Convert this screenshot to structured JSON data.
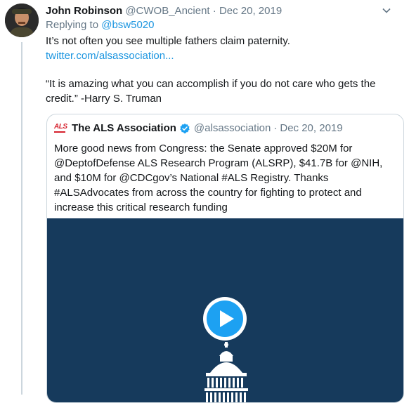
{
  "tweet": {
    "author_name": "John Robinson",
    "handle": "@CWOB_Ancient",
    "separator": "·",
    "date": "Dec 20, 2019",
    "replying_to_label": "Replying to",
    "replying_to_handle": "@bsw5020",
    "line1": "It’s not often you see multiple fathers claim paternity.",
    "link": "twitter.com/alsassociation...",
    "quote_line": "“It is amazing what you can accomplish if you do not care who gets the credit.” -Harry S. Truman"
  },
  "quoted": {
    "logo_text": "ALS",
    "name": "The ALS Association",
    "handle": "@alsassociation",
    "separator": "·",
    "date": "Dec 20, 2019",
    "text": "More good news from Congress: the Senate approved $20M for @DeptofDefense ALS Research Program (ALSRP), $41.7B for @NIH, and $10M for @CDCgov’s National #ALS Registry. Thanks #ALSAdvocates from across the country for fighting to protect and increase this critical research funding",
    "media_icon": "play-icon"
  },
  "colors": {
    "link": "#1b95e0",
    "muted": "#657786",
    "media_bg": "#163a5c",
    "verified": "#1da1f2",
    "brand_red": "#d6212d"
  }
}
